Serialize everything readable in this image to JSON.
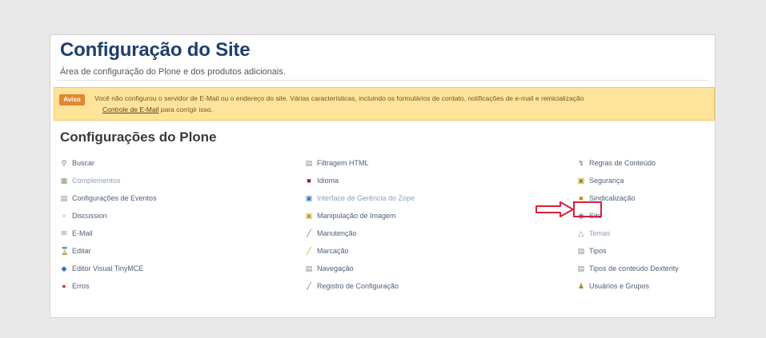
{
  "page": {
    "title": "Configuração do Site",
    "subtitle": "Área de configuração do Plone e dos produtos adicionais."
  },
  "alert": {
    "badge": "Aviso",
    "text": "Você não configurou o servidor de E-Mail ou o endereço do site. Várias características, incluindo os formulários de contato, notificações de e-mail e reinicialização",
    "link": "Controle de E-Mail",
    "suffix": " para corrigir isso."
  },
  "section": {
    "title": "Configurações do Plone"
  },
  "columns": {
    "left": [
      {
        "label": "Buscar",
        "icon": "magnifier-icon"
      },
      {
        "label": "Complementos",
        "icon": "addons-icon"
      },
      {
        "label": "Configurações de Eventos",
        "icon": "document-icon"
      },
      {
        "label": "Discussion",
        "icon": "discussion-icon"
      },
      {
        "label": "E-Mail",
        "icon": "mail-icon"
      },
      {
        "label": "Editar",
        "icon": "edit-icon"
      },
      {
        "label": "Editor Visual TinyMCE",
        "icon": "tinymce-icon"
      },
      {
        "label": "Erros",
        "icon": "error-icon"
      }
    ],
    "middle": [
      {
        "label": "Filtragem HTML",
        "icon": "document-icon"
      },
      {
        "label": "Idioma",
        "icon": "flag-icon"
      },
      {
        "label": "Interface de Gerência do Zope",
        "icon": "zope-icon"
      },
      {
        "label": "Manipulação de Imagem",
        "icon": "image-icon"
      },
      {
        "label": "Manutenção",
        "icon": "wrench-icon"
      },
      {
        "label": "Marcação",
        "icon": "pencil-icon"
      },
      {
        "label": "Navegação",
        "icon": "navigation-icon"
      },
      {
        "label": "Registro de Configuração",
        "icon": "wrench-icon"
      }
    ],
    "right": [
      {
        "label": "Regras de Conteúdo",
        "icon": "rules-icon"
      },
      {
        "label": "Segurança",
        "icon": "lock-icon"
      },
      {
        "label": "Sindicalização",
        "icon": "rss-icon"
      },
      {
        "label": "Site",
        "icon": "globe-icon"
      },
      {
        "label": "Temas",
        "icon": "theme-icon"
      },
      {
        "label": "Tipos",
        "icon": "document-icon"
      },
      {
        "label": "Tipos de conteúdo Dexterity",
        "icon": "document-icon"
      },
      {
        "label": "Usuários e Grupos",
        "icon": "users-icon"
      }
    ]
  },
  "colors": {
    "title": "#1f3f6b",
    "link": "#4d5f78",
    "alert_bg": "#fde49a",
    "alert_badge": "#e3862f",
    "highlight": "#d81f3a"
  }
}
